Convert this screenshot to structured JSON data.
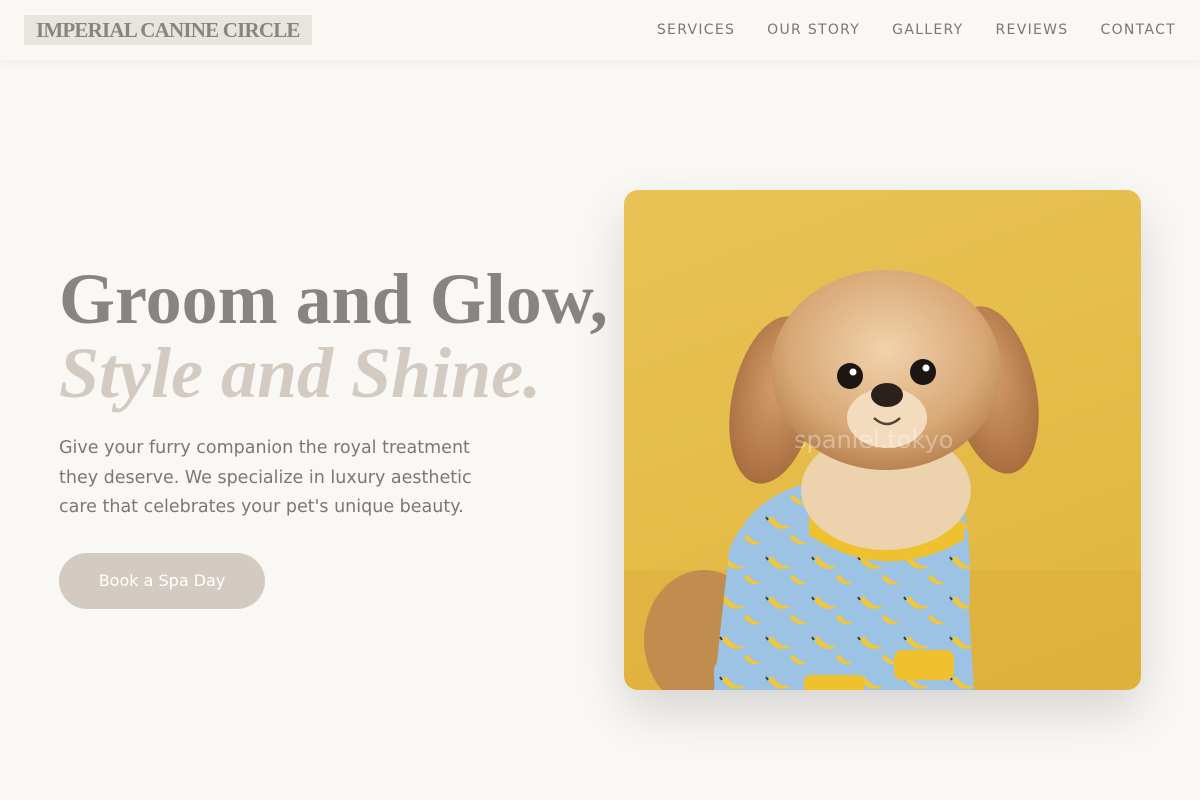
{
  "brand": {
    "name": "IMPERIAL CANINE CIRCLE"
  },
  "nav": {
    "items": [
      {
        "label": "SERVICES"
      },
      {
        "label": "OUR STORY"
      },
      {
        "label": "GALLERY"
      },
      {
        "label": "REVIEWS"
      },
      {
        "label": "CONTACT"
      }
    ]
  },
  "hero": {
    "headline_line1": "Groom and Glow,",
    "headline_line2": "Style and Shine.",
    "description": "Give your furry companion the royal treatment they deserve. We specialize in luxury aesthetic care that celebrates your pet's unique beauty.",
    "cta_label": "Book a Spa Day",
    "image": {
      "subject": "dog-in-banana-pajamas-photo",
      "watermark_text": "spaniel.tokyo"
    }
  },
  "colors": {
    "background": "#faf8f5",
    "text_primary": "#8a8480",
    "accent_beige": "#d3cbc2",
    "nav_text": "#7b7774",
    "photo_background": "#e6bd4a"
  }
}
